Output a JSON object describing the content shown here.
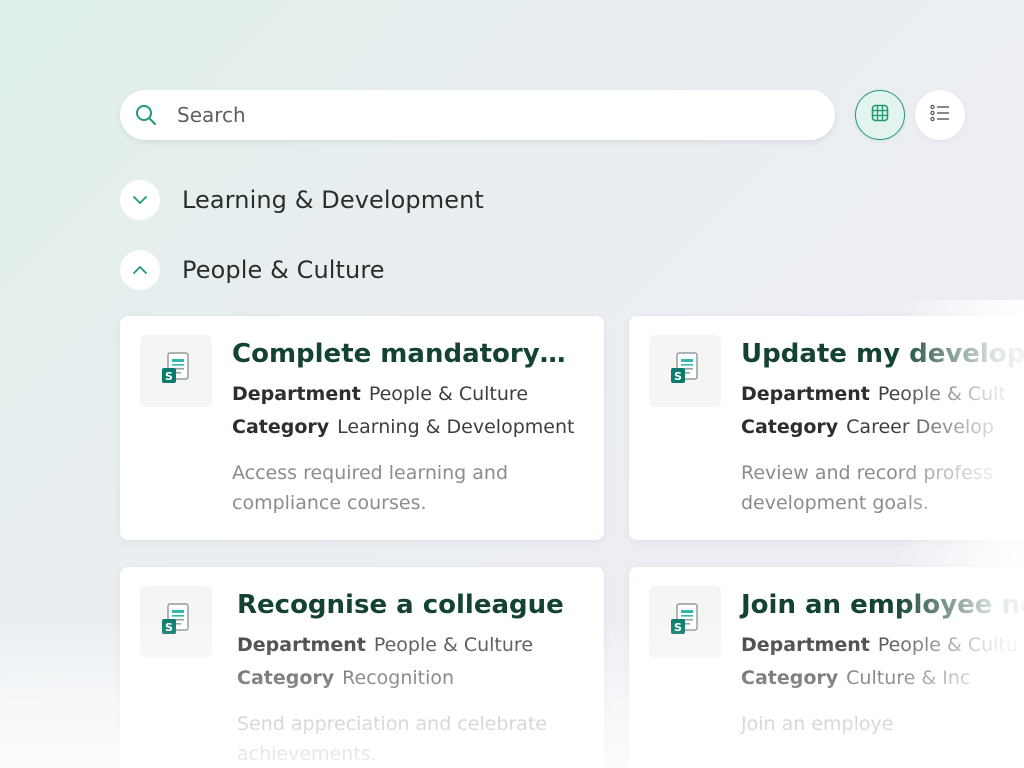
{
  "search": {
    "placeholder": "Search",
    "icon": "search-icon"
  },
  "view_toggle": {
    "grid_icon": "grid-view-icon",
    "list_icon": "list-view-icon",
    "active": "grid"
  },
  "sections": [
    {
      "title": "Learning & Development",
      "expanded": false
    },
    {
      "title": "People & Culture",
      "expanded": true
    }
  ],
  "cards": [
    {
      "title": "Complete mandatory…",
      "department_label": "Department",
      "department": "People & Culture",
      "category_label": "Category",
      "category": "Learning & Development",
      "description": "Access required learning and compliance courses.",
      "icon": "sharepoint-icon"
    },
    {
      "title": "Update my develop",
      "department_label": "Department",
      "department": "People & Cult",
      "category_label": "Category",
      "category": "Career Develop",
      "description": "Review and record profess development goals.",
      "icon": "sharepoint-icon"
    },
    {
      "title": "Recognise a colleague",
      "department_label": "Department",
      "department": "People & Culture",
      "category_label": "Category",
      "category": "Recognition",
      "description": "Send appreciation and celebrate achievements.",
      "icon": "sharepoint-icon"
    },
    {
      "title": "Join an employee ne",
      "department_label": "Department",
      "department": "People & Cultu",
      "category_label": "Category",
      "category": "Culture & Inc",
      "description": "Join an employe",
      "icon": "sharepoint-icon"
    }
  ],
  "colors": {
    "accent": "#1f9a78",
    "title": "#14432f",
    "sharepoint_teal": "#0b7a6e"
  }
}
